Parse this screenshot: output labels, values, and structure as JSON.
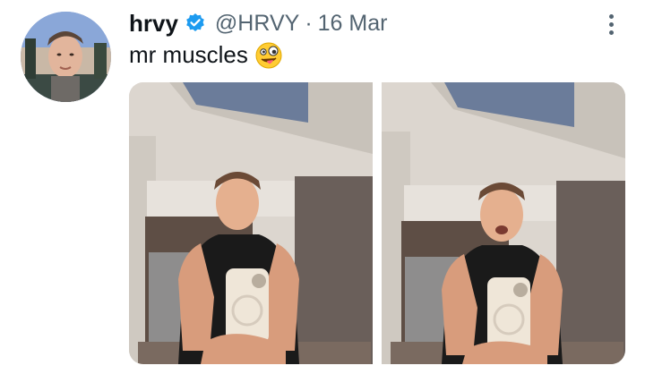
{
  "tweet": {
    "author_name": "hrvy",
    "handle": "@HRVY",
    "separator": "·",
    "date": "16 Mar",
    "text": "mr muscles",
    "emoji": "zany-face",
    "verified": true
  },
  "icons": {
    "verified": "verified-badge-icon",
    "more": "more-options-icon"
  },
  "media": {
    "count": 2,
    "photos": [
      {
        "description_icon": "photo-1"
      },
      {
        "description_icon": "photo-2"
      }
    ]
  },
  "colors": {
    "text_primary": "#0f1419",
    "text_secondary": "#536471",
    "verified_blue": "#1d9bf0"
  }
}
